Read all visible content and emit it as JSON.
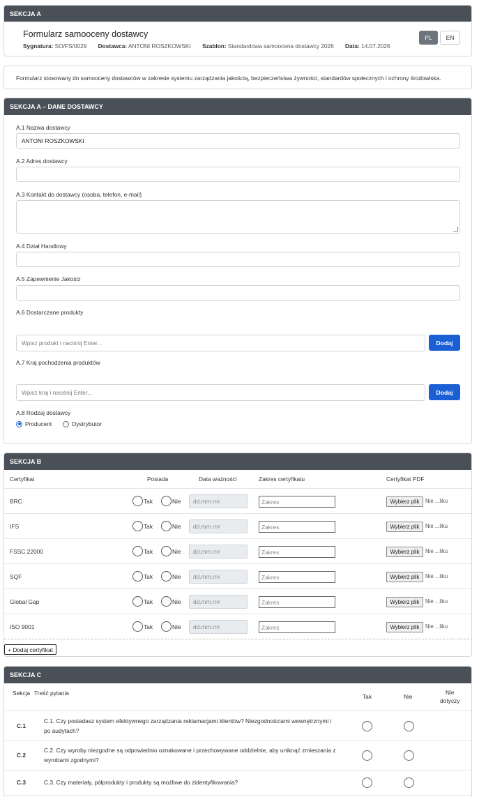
{
  "header": {
    "section_label": "SEKCJA A",
    "title": "Formularz samooceny dostawcy",
    "meta": [
      {
        "label": "Sygnatura:",
        "value": "SO/FS/0029"
      },
      {
        "label": "Dostawca:",
        "value": "ANTONI ROSZKOWSKI"
      },
      {
        "label": "Szablon:",
        "value": "Standardowa samoocena dostawcy 2026"
      },
      {
        "label": "Data:",
        "value": "14.07.2026"
      }
    ],
    "lang_pl": "PL",
    "lang_en": "EN"
  },
  "description": "Formularz stosowany do samooceny dostawców w zakresie systemu zarządzania jakością, bezpieczeństwa żywności, standardów społecznych i ochrony środowiska.",
  "section_a": {
    "title": "SEKCJA A – DANE DOSTAWCY",
    "a1_label": "A.1 Nazwa dostawcy",
    "a1_value": "ANTONI ROSZKOWSKI",
    "a2_label": "A.2 Adres dostawcy",
    "a3_label": "A.3 Kontakt do dostawcy (osoba, telefon, e-mail)",
    "a4_label": "A.4 Dział Handlowy",
    "a5_label": "A.5 Zapewnienie Jakości",
    "a6_label": "A.6 Dostarczane produkty",
    "a6_placeholder": "Wpisz produkt i naciśnij Enter...",
    "a7_label": "A.7 Kraj pochodzenia produktów",
    "a7_placeholder": "Wpisz kraj i naciśnij Enter...",
    "add_label": "Dodaj",
    "a8_label": "A.8 Rodzaj dostawcy",
    "a8_options": [
      "Producent",
      "Dystrybutor"
    ],
    "a8_selected": "Producent"
  },
  "section_b": {
    "title": "SEKCJA B",
    "columns": [
      "Certyfikat",
      "Posiada",
      "Data ważności",
      "Zakres certyfikatu",
      "Certyfikat PDF"
    ],
    "yes": "Tak",
    "no": "Nie",
    "date_placeholder": "dd.mm.rrrr",
    "scope_placeholder": "Zakres",
    "file_button": "Wybierz plik",
    "file_status": "Nie ...liku",
    "rows": [
      "BRC",
      "IFS",
      "FSSC 22000",
      "SQF",
      "Global Gap",
      "ISO 9001"
    ],
    "add_cert": "+ Dodaj certyfikat"
  },
  "section_c": {
    "title": "SEKCJA C",
    "columns": {
      "section": "Sekcja",
      "question": "Treść pytania",
      "yes": "Tak",
      "no": "Nie",
      "na_line1": "Nie",
      "na_line2": "dotyczy"
    },
    "rows": [
      {
        "code": "C.1",
        "question": "C.1. Czy posiadasz system efektywnego zarządzania reklamacjami klientów? Niezgodnościami wewnętrznymi i po audytach?"
      },
      {
        "code": "C.2",
        "question": "C.2. Czy wyroby niezgodne są odpowiednio oznakowane i przechowywane oddzielnie, aby uniknąć zmieszania z wyrobami zgodnymi?"
      },
      {
        "code": "C.3",
        "question": "C.3. Czy materiały, półprodukty i produkty są możliwe do zidentyfikowania?"
      }
    ]
  }
}
